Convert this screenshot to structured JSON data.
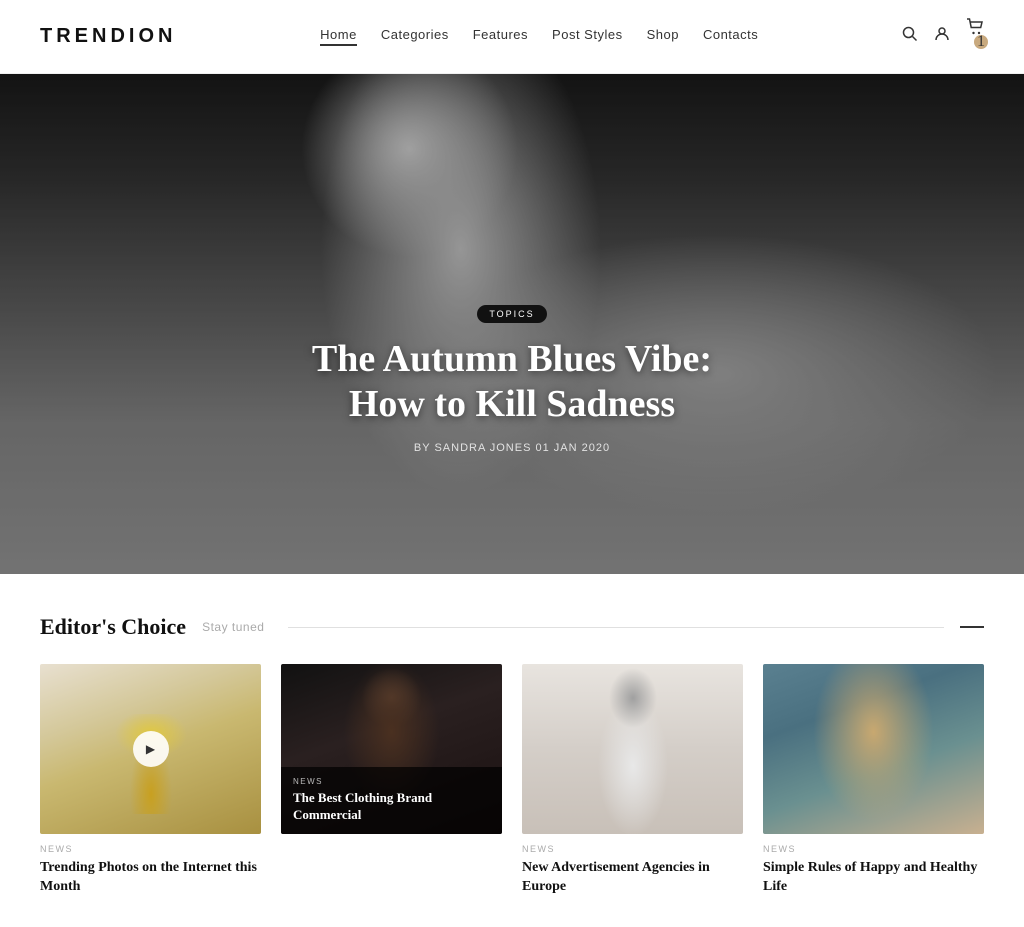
{
  "header": {
    "logo": "TRENDION",
    "nav": [
      {
        "label": "Home",
        "active": true
      },
      {
        "label": "Categories",
        "active": false
      },
      {
        "label": "Features",
        "active": false
      },
      {
        "label": "Post Styles",
        "active": false
      },
      {
        "label": "Shop",
        "active": false
      },
      {
        "label": "Contacts",
        "active": false
      }
    ],
    "cart_count": "1"
  },
  "hero": {
    "tag": "TOPICS",
    "title": "The Autumn Blues Vibe:\nHow to Kill Sadness",
    "meta": "By Sandra Jones   01 Jan 2020"
  },
  "editors_choice": {
    "title": "Editor's Choice",
    "subtitle": "Stay tuned",
    "cards": [
      {
        "tag": "NEWS",
        "title": "Trending Photos on the Internet this Month",
        "has_play": true
      },
      {
        "tag": "NEWS",
        "title": "The Best Clothing Brand Commercial",
        "overlay": true
      },
      {
        "tag": "NEWS",
        "title": "New Advertisement Agencies in Europe",
        "overlay": false
      },
      {
        "tag": "NEWS",
        "title": "Simple Rules of Happy and Healthy Life",
        "overlay": false
      }
    ]
  }
}
